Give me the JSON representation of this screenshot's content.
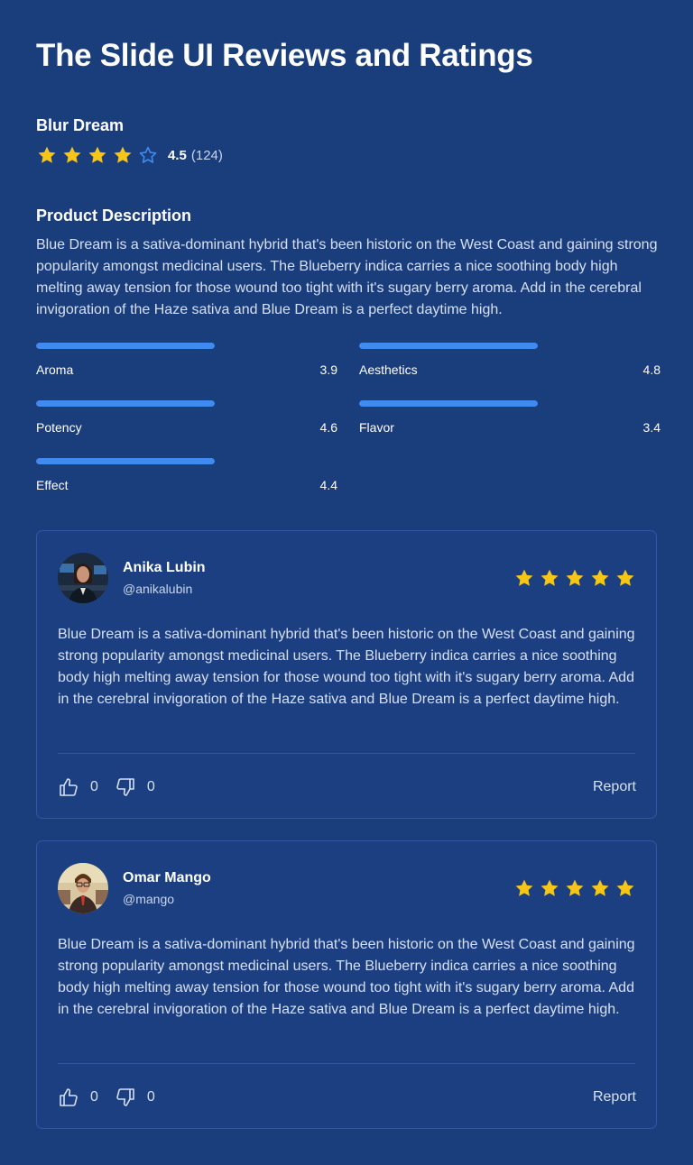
{
  "page_title": "The Slide UI Reviews and Ratings",
  "product": {
    "name": "Blur Dream",
    "rating": "4.5",
    "rating_stars": 4.5,
    "review_count": "(124)"
  },
  "description": {
    "heading": "Product Description",
    "text": "Blue Dream is a sativa-dominant hybrid that's been historic on the West Coast and gaining strong popularity amongst medicinal users. The Blueberry indica carries a nice soothing body high melting away tension for those wound too tight with it's sugary berry aroma. Add in the cerebral invigoration of the Haze sativa and Blue Dream is a perfect daytime high."
  },
  "metrics": [
    {
      "label": "Aroma",
      "value": "3.9",
      "fill": 1.0
    },
    {
      "label": "Aesthetics",
      "value": "4.8",
      "fill": 1.0
    },
    {
      "label": "Potency",
      "value": "4.6",
      "fill": 1.0
    },
    {
      "label": "Flavor",
      "value": "3.4",
      "fill": 1.0
    },
    {
      "label": "Effect",
      "value": "4.4",
      "fill": 1.0
    }
  ],
  "reviews": [
    {
      "name": "Anika Lubin",
      "handle": "@anikalubin",
      "stars": 5,
      "text": "Blue Dream is a sativa-dominant hybrid that's been historic on the West Coast and gaining strong popularity amongst medicinal users. The Blueberry indica carries a nice soothing body high melting away tension for those wound too tight with it's sugary berry aroma. Add in the cerebral invigoration of the Haze sativa and Blue Dream is a perfect daytime high.",
      "likes": "0",
      "dislikes": "0",
      "report_label": "Report"
    },
    {
      "name": "Omar Mango",
      "handle": "@mango",
      "stars": 5,
      "text": "Blue Dream is a sativa-dominant hybrid that's been historic on the West Coast and gaining strong popularity amongst medicinal users. The Blueberry indica carries a nice soothing body high melting away tension for those wound too tight with it's sugary berry aroma. Add in the cerebral invigoration of the Haze sativa and Blue Dream is a perfect daytime high.",
      "likes": "0",
      "dislikes": "0",
      "report_label": "Report"
    }
  ],
  "icons": {
    "star_filled": "star-icon",
    "star_outline": "star-outline-icon",
    "like": "thumbs-up-icon",
    "dislike": "thumbs-down-icon"
  },
  "colors": {
    "background": "#1a3d7c",
    "star": "#f5c518",
    "star_outline": "#3f8bf0",
    "bar": "#3f8bf0"
  }
}
